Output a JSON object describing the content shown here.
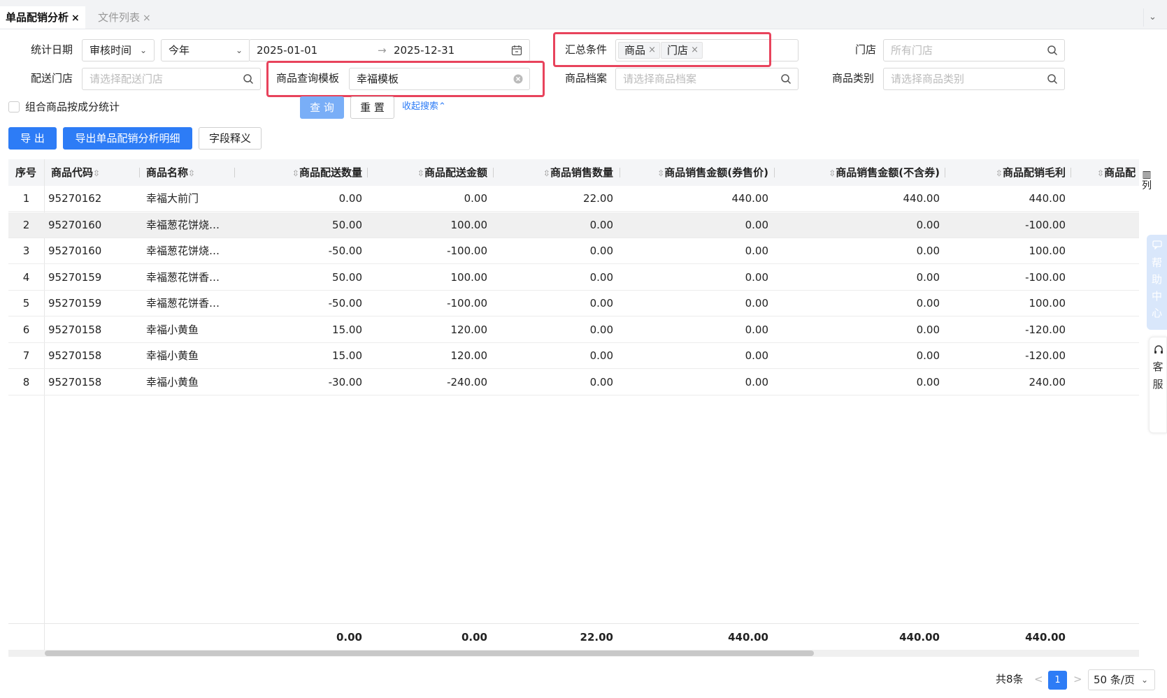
{
  "tabs": [
    {
      "label": "单品配销分析",
      "close": "×"
    },
    {
      "label": "文件列表",
      "close": "×"
    }
  ],
  "tabs_menu_icon": "chevron-down-icon",
  "filters": {
    "stat_date_label": "统计日期",
    "date_type": "审核时间",
    "period": "今年",
    "date_start": "2025-01-01",
    "date_sep": "→",
    "date_end": "2025-12-31",
    "summary_label": "汇总条件",
    "summary_tags": [
      "商品",
      "门店"
    ],
    "tag_close": "×",
    "store_label": "门店",
    "store_placeholder": "所有门店",
    "delivery_store_label": "配送门店",
    "delivery_store_placeholder": "请选择配送门店",
    "template_label": "商品查询模板",
    "template_value": "幸福模板",
    "goods_archive_label": "商品档案",
    "goods_archive_placeholder": "请选择商品档案",
    "goods_category_label": "商品类别",
    "goods_category_placeholder": "请选择商品类别",
    "combo_checkbox_label": "组合商品按成分统计",
    "query_button": "查 询",
    "reset_button": "重 置",
    "collapse_link": "收起搜索",
    "collapse_icon": "⌃"
  },
  "toolbar": {
    "export": "导 出",
    "export_detail": "导出单品配销分析明细",
    "field_help": "字段释义"
  },
  "table": {
    "headers": [
      "序号",
      "商品代码",
      "商品名称",
      "商品配送数量",
      "商品配送金额",
      "商品销售数量",
      "商品销售金额(券售价)",
      "商品销售金额(不含券)",
      "商品配销毛利",
      "商品配"
    ],
    "sort_icon": "⇳",
    "rows": [
      [
        "1",
        "95270162",
        "幸福大前门",
        "0.00",
        "0.00",
        "22.00",
        "440.00",
        "440.00",
        "440.00"
      ],
      [
        "2",
        "95270160",
        "幸福葱花饼烧…",
        "50.00",
        "100.00",
        "0.00",
        "0.00",
        "0.00",
        "-100.00"
      ],
      [
        "3",
        "95270160",
        "幸福葱花饼烧…",
        "-50.00",
        "-100.00",
        "0.00",
        "0.00",
        "0.00",
        "100.00"
      ],
      [
        "4",
        "95270159",
        "幸福葱花饼香…",
        "50.00",
        "100.00",
        "0.00",
        "0.00",
        "0.00",
        "-100.00"
      ],
      [
        "5",
        "95270159",
        "幸福葱花饼香…",
        "-50.00",
        "-100.00",
        "0.00",
        "0.00",
        "0.00",
        "100.00"
      ],
      [
        "6",
        "95270158",
        "幸福小黄鱼",
        "15.00",
        "120.00",
        "0.00",
        "0.00",
        "0.00",
        "-120.00"
      ],
      [
        "7",
        "95270158",
        "幸福小黄鱼",
        "15.00",
        "120.00",
        "0.00",
        "0.00",
        "0.00",
        "-120.00"
      ],
      [
        "8",
        "95270158",
        "幸福小黄鱼",
        "-30.00",
        "-240.00",
        "0.00",
        "0.00",
        "0.00",
        "240.00"
      ]
    ],
    "totals": [
      "0.00",
      "0.00",
      "22.00",
      "440.00",
      "440.00",
      "440.00"
    ],
    "columns_button": "列",
    "columns_icon": "▥"
  },
  "side": {
    "help": "帮助中心",
    "help_icon": "chat-icon",
    "service": "客服",
    "service_icon": "headset-icon"
  },
  "pagination": {
    "total": "共8条",
    "prev": "<",
    "current": "1",
    "next": ">",
    "page_size": "50 条/页"
  },
  "colors": {
    "primary": "#2d7cf6",
    "highlight_box": "#e8435c",
    "header_bg": "#f4f5f7"
  }
}
